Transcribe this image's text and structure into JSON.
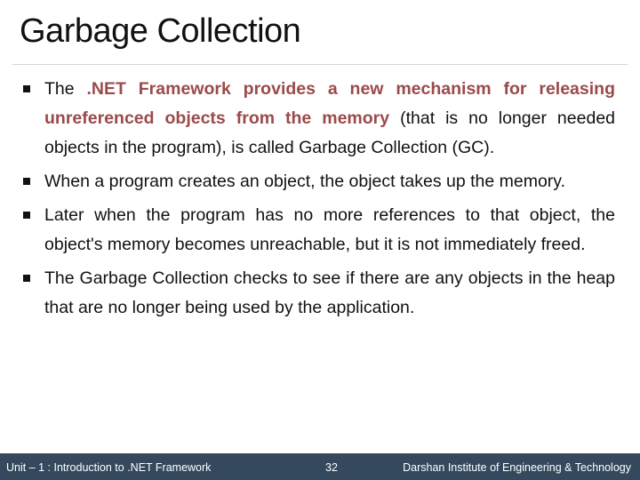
{
  "slide": {
    "title": "Garbage Collection",
    "bullets": [
      {
        "pre": "The ",
        "highlight": ".NET Framework provides a new mechanism for releasing unreferenced objects from the memory",
        "post": " (that is no longer needed objects in the program), is called Garbage Collection (GC)."
      },
      {
        "text": "When a program creates an object, the object takes up the memory."
      },
      {
        "text": "Later when the program has no more references to that object, the object's memory becomes unreachable, but it is not immediately freed."
      },
      {
        "text": "The Garbage Collection checks to see if there are any objects in the heap that are no longer being used by the application."
      }
    ]
  },
  "footer": {
    "unit": "Unit – 1 : Introduction to .NET Framework",
    "page": "32",
    "institute": "Darshan Institute of Engineering & Technology"
  },
  "colors": {
    "highlight": "#9b4a4a",
    "footer_bg": "#34495e"
  }
}
